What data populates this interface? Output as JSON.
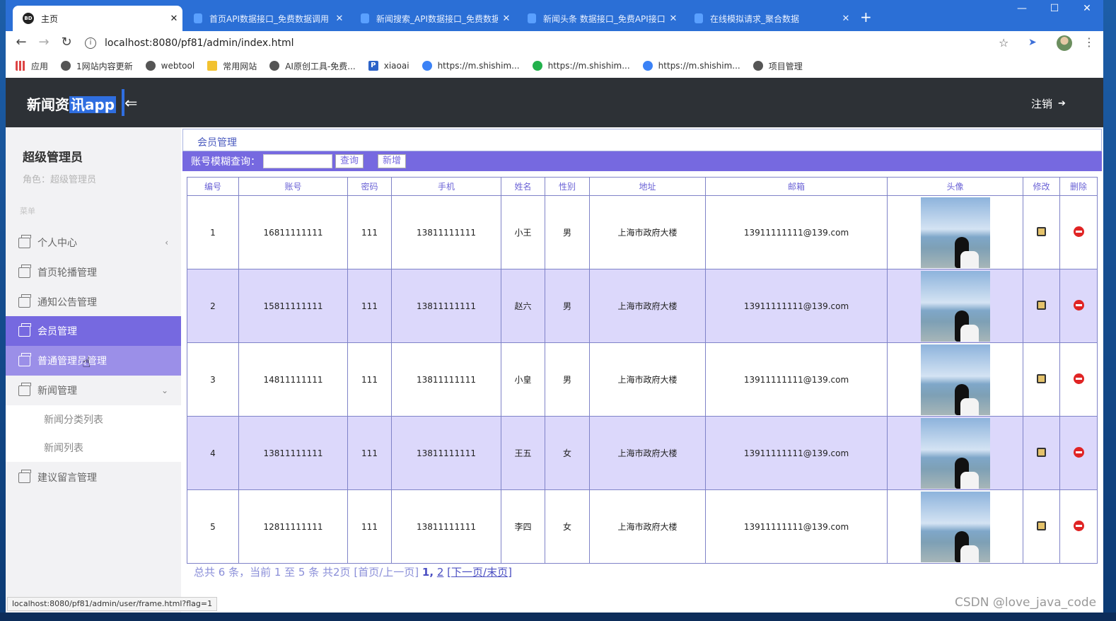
{
  "browser": {
    "tabs": [
      {
        "title": "主页",
        "favicon": "BD",
        "active": true
      },
      {
        "title": "首页API数据接口_免费数据调用",
        "active": false
      },
      {
        "title": "新闻搜索_API数据接口_免费数据",
        "active": false
      },
      {
        "title": "新闻头条 数据接口_免费API接口",
        "active": false
      },
      {
        "title": "在线模拟请求_聚合数据",
        "active": false
      }
    ],
    "url": "localhost:8080/pf81/admin/index.html",
    "bookmarks": [
      "应用",
      "1网站内容更新",
      "webtool",
      "常用网站",
      "AI原创工具-免费...",
      "xiaoai",
      "https://m.shishim...",
      "https://m.shishim...",
      "https://m.shishim...",
      "项目管理"
    ],
    "status_url": "localhost:8080/pf81/admin/user/frame.html?flag=1"
  },
  "app": {
    "logo_prefix": "新闻资",
    "logo_highlight": "讯app",
    "logout_label": "注销"
  },
  "sidebar": {
    "user_name": "超级管理员",
    "role_text": "角色：超级管理员",
    "menu_heading": "菜单",
    "items": [
      {
        "label": "个人中心"
      },
      {
        "label": "首页轮播管理"
      },
      {
        "label": "通知公告管理"
      },
      {
        "label": "会员管理"
      },
      {
        "label": "普通管理员管理"
      },
      {
        "label": "新闻管理"
      },
      {
        "label": "建议留言管理"
      }
    ],
    "sub_items": [
      {
        "label": "新闻分类列表"
      },
      {
        "label": "新闻列表"
      }
    ]
  },
  "main": {
    "breadcrumb": "会员管理",
    "search_label": "账号模糊查询：",
    "search_value": "",
    "search_button": "查询",
    "add_button": "新增",
    "columns": [
      "编号",
      "账号",
      "密码",
      "手机",
      "姓名",
      "性别",
      "地址",
      "邮箱",
      "头像",
      "修改",
      "删除"
    ],
    "rows": [
      {
        "id": "1",
        "account": "16811111111",
        "password": "111",
        "phone": "13811111111",
        "name": "小王",
        "gender": "男",
        "address": "上海市政府大楼",
        "email": "13911111111@139.com"
      },
      {
        "id": "2",
        "account": "15811111111",
        "password": "111",
        "phone": "13811111111",
        "name": "赵六",
        "gender": "男",
        "address": "上海市政府大楼",
        "email": "13911111111@139.com"
      },
      {
        "id": "3",
        "account": "14811111111",
        "password": "111",
        "phone": "13811111111",
        "name": "小皇",
        "gender": "男",
        "address": "上海市政府大楼",
        "email": "13911111111@139.com"
      },
      {
        "id": "4",
        "account": "13811111111",
        "password": "111",
        "phone": "13811111111",
        "name": "王五",
        "gender": "女",
        "address": "上海市政府大楼",
        "email": "13911111111@139.com"
      },
      {
        "id": "5",
        "account": "12811111111",
        "password": "111",
        "phone": "13811111111",
        "name": "李四",
        "gender": "女",
        "address": "上海市政府大楼",
        "email": "13911111111@139.com"
      }
    ],
    "pager": {
      "summary": "总共 6 条，当前 1 至 5 条 共2页",
      "first_prev": "[首页/上一页]",
      "page1": "1",
      "sep": ",",
      "page2": "2",
      "next_last_prefix": "[",
      "next": "下一页",
      "slash": "/",
      "last": "末页",
      "suffix": "]"
    }
  },
  "watermark": "CSDN @love_java_code",
  "colors": {
    "accent": "#7669e0",
    "header": "#2d3136",
    "row_alt": "#dcd8fb",
    "tabbar": "#2b6fd6"
  }
}
